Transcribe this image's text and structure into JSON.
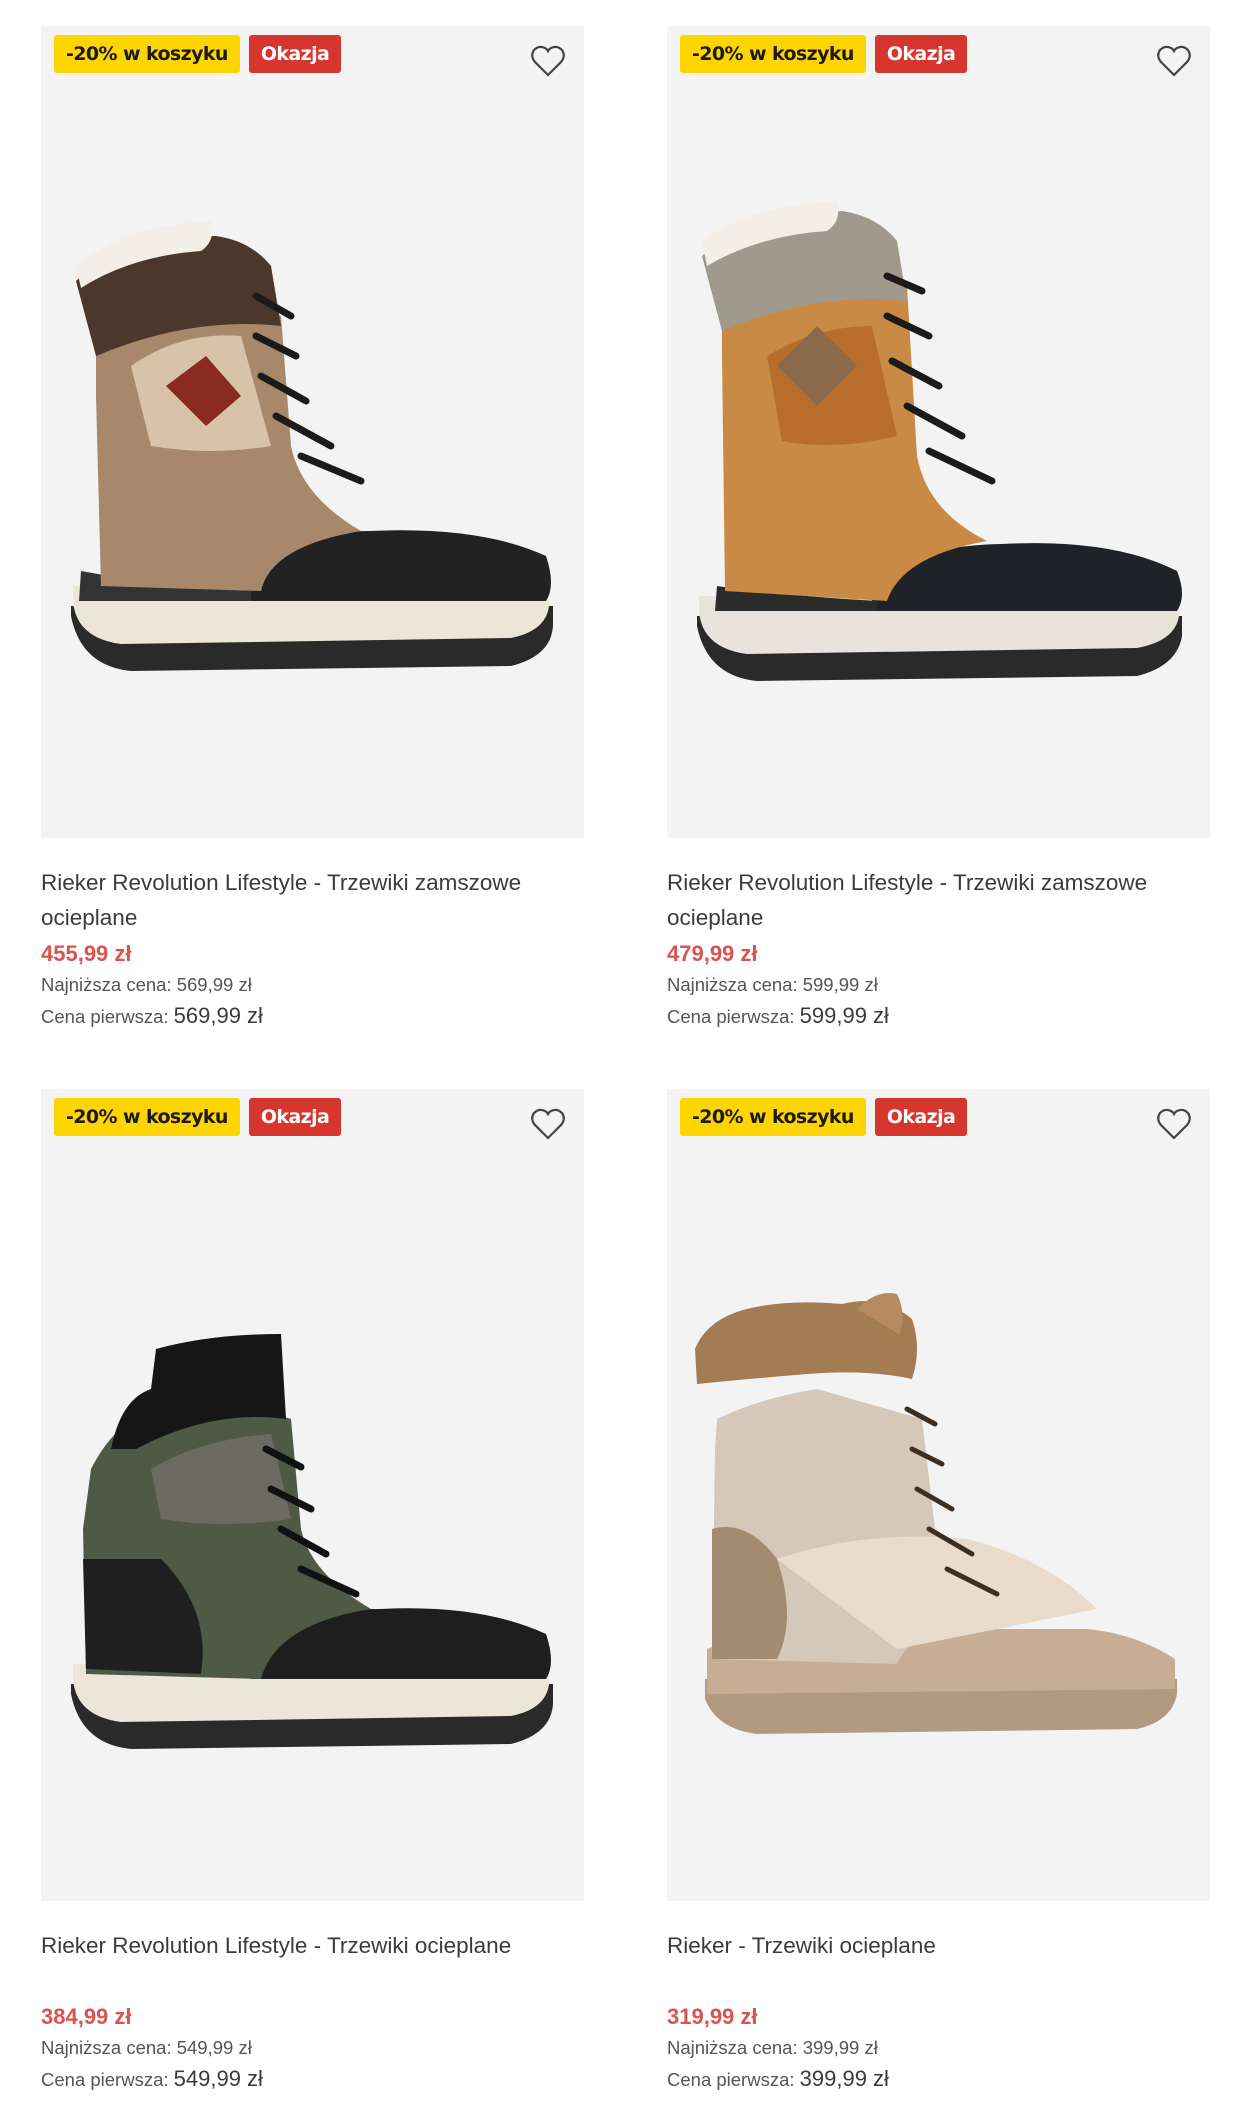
{
  "colors": {
    "promo_badge": "#ffd500",
    "deal_badge": "#d7362f",
    "price": "#d9534f",
    "image_bg": "#f3f3f3"
  },
  "products": [
    {
      "promo": "-20% w koszyku",
      "deal": "Okazja",
      "favorite_icon": "heart-outline-icon",
      "title": "Rieker Revolution Lifestyle - Trzewiki zamszowe ocieplane",
      "price": "455,99 zł",
      "lowest_label": "Najniższa cena:",
      "lowest_value": "569,99 zł",
      "first_label": "Cena pierwsza:",
      "first_value": "569,99 zł"
    },
    {
      "promo": "-20% w koszyku",
      "deal": "Okazja",
      "favorite_icon": "heart-outline-icon",
      "title": "Rieker Revolution Lifestyle - Trzewiki zamszowe ocieplane",
      "price": "479,99 zł",
      "lowest_label": "Najniższa cena:",
      "lowest_value": "599,99 zł",
      "first_label": "Cena pierwsza:",
      "first_value": "599,99 zł"
    },
    {
      "promo": "-20% w koszyku",
      "deal": "Okazja",
      "favorite_icon": "heart-outline-icon",
      "title": "Rieker Revolution Lifestyle - Trzewiki ocieplane",
      "price": "384,99 zł",
      "lowest_label": "Najniższa cena:",
      "lowest_value": "549,99 zł",
      "first_label": "Cena pierwsza:",
      "first_value": "549,99 zł"
    },
    {
      "promo": "-20% w koszyku",
      "deal": "Okazja",
      "favorite_icon": "heart-outline-icon",
      "title": "Rieker - Trzewiki ocieplane",
      "price": "319,99 zł",
      "lowest_label": "Najniższa cena:",
      "lowest_value": "399,99 zł",
      "first_label": "Cena pierwsza:",
      "first_value": "399,99 zł"
    }
  ]
}
